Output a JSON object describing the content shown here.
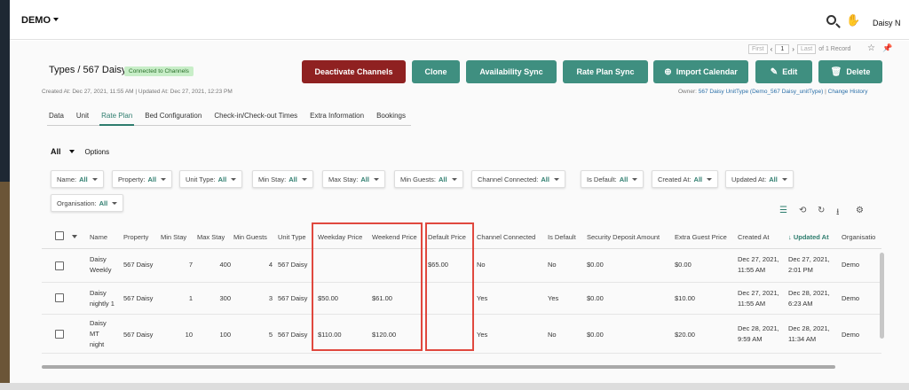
{
  "topbar": {
    "brand": "DEMO",
    "user": "Daisy N"
  },
  "pager": {
    "first": "First",
    "page": "1",
    "last": "Last",
    "of": "of 1 Record"
  },
  "header": {
    "title": "Types / 567 Daisy",
    "badge": "Connected to Channels",
    "meta": "Created At: Dec 27, 2021, 11:55 AM  |  Updated At: Dec 27, 2021, 12:23 PM",
    "owner_label": "Owner:",
    "owner_value": "567 Daisy UnitType (Demo_567 Daisy_unitType)",
    "sep": "|",
    "change_history": "Change History"
  },
  "actions": {
    "deactivate": "Deactivate Channels",
    "clone": "Clone",
    "availability_sync": "Availability Sync",
    "rate_plan_sync": "Rate Plan Sync",
    "import_calendar": "Import Calendar",
    "edit": "Edit",
    "delete": "Delete"
  },
  "tabs": [
    "Data",
    "Unit",
    "Rate Plan",
    "Bed Configuration",
    "Check-in/Check-out Times",
    "Extra Information",
    "Bookings"
  ],
  "active_tab": "Rate Plan",
  "view": {
    "selected": "All",
    "options": "Options"
  },
  "filters": [
    {
      "label": "Name:",
      "value": "All"
    },
    {
      "label": "Property:",
      "value": "All"
    },
    {
      "label": "Unit Type:",
      "value": "All"
    },
    {
      "label": "Min Stay:",
      "value": "All"
    },
    {
      "label": "Max Stay:",
      "value": "All"
    },
    {
      "label": "Min Guests:",
      "value": "All"
    },
    {
      "label": "Channel Connected:",
      "value": "All"
    },
    {
      "label": "Is Default:",
      "value": "All"
    },
    {
      "label": "Created At:",
      "value": "All"
    },
    {
      "label": "Updated At:",
      "value": "All"
    },
    {
      "label": "Organisation:",
      "value": "All"
    }
  ],
  "table": {
    "columns": [
      "Name",
      "Property",
      "Min Stay",
      "Max Stay",
      "Min Guests",
      "Unit Type",
      "Weekday Price",
      "Weekend Price",
      "Default Price",
      "Channel Connected",
      "Is Default",
      "Security Deposit Amount",
      "Extra Guest Price",
      "Created At",
      "Updated At",
      "Organisatio"
    ],
    "sort_arrow": "↓",
    "rows": [
      {
        "name": [
          "Daisy",
          "Weekly"
        ],
        "property": "567 Daisy",
        "min_stay": "7",
        "max_stay": "400",
        "min_guests": "4",
        "unit_type": "567 Daisy",
        "weekday": "",
        "weekend": "",
        "default": "$65.00",
        "channel": "No",
        "is_default": "No",
        "deposit": "$0.00",
        "extra_guest": "$0.00",
        "created": [
          "Dec 27, 2021,",
          "11:55 AM"
        ],
        "updated": [
          "Dec 27, 2021,",
          "2:01 PM"
        ],
        "org": "Demo"
      },
      {
        "name": [
          "Daisy",
          "nightly 1"
        ],
        "property": "567 Daisy",
        "min_stay": "1",
        "max_stay": "300",
        "min_guests": "3",
        "unit_type": "567 Daisy",
        "weekday": "$50.00",
        "weekend": "$61.00",
        "default": "",
        "channel": "Yes",
        "is_default": "Yes",
        "deposit": "$0.00",
        "extra_guest": "$10.00",
        "created": [
          "Dec 27, 2021,",
          "11:55 AM"
        ],
        "updated": [
          "Dec 28, 2021,",
          "6:23 AM"
        ],
        "org": "Demo"
      },
      {
        "name": [
          "Daisy",
          "MT",
          "night"
        ],
        "property": "567 Daisy",
        "min_stay": "10",
        "max_stay": "100",
        "min_guests": "5",
        "unit_type": "567 Daisy",
        "weekday": "$110.00",
        "weekend": "$120.00",
        "default": "",
        "channel": "Yes",
        "is_default": "No",
        "deposit": "$0.00",
        "extra_guest": "$20.00",
        "created": [
          "Dec 28, 2021,",
          "9:59 AM"
        ],
        "updated": [
          "Dec 28, 2021,",
          "11:34 AM"
        ],
        "org": "Demo"
      }
    ]
  },
  "colors": {
    "teal": "#3f8f80",
    "red": "#8f2121",
    "highlight": "#e0483e",
    "accent": "#2e7d6e"
  },
  "icons": [
    "search-icon",
    "hand-icon",
    "star-icon",
    "pin-icon",
    "plus-circle-icon",
    "edit-icon",
    "trash-icon",
    "filter-lines-icon",
    "refresh-icon",
    "reload-icon",
    "download-icon",
    "gear-icon"
  ]
}
